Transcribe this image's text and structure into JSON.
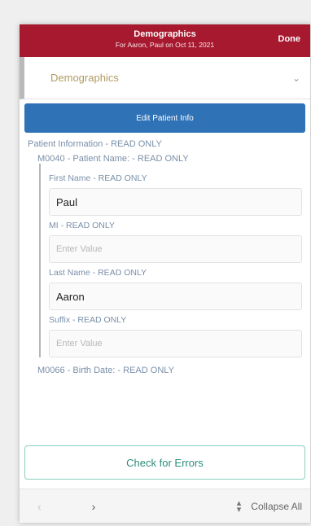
{
  "header": {
    "title": "Demographics",
    "subtitle": "For Aaron, Paul on Oct 11, 2021",
    "done_label": "Done"
  },
  "section": {
    "label": "Demographics",
    "chevron_icon": "chevron-down-icon"
  },
  "edit_button_label": "Edit Patient Info",
  "content": {
    "group_title": "Patient Information - READ ONLY",
    "patient_name_group": "M0040 - Patient Name: - READ ONLY",
    "fields": [
      {
        "label": "First Name - READ ONLY",
        "value": "Paul"
      },
      {
        "label": "MI - READ ONLY",
        "placeholder": "Enter Value"
      },
      {
        "label": "Last Name - READ ONLY",
        "value": "Aaron"
      },
      {
        "label": "Suffix - READ ONLY",
        "placeholder": "Enter Value"
      }
    ],
    "next_group": "M0066 - Birth Date: - READ ONLY"
  },
  "check_button_label": "Check for Errors",
  "footer": {
    "prev_icon": "chevron-left-icon",
    "next_icon": "chevron-right-icon",
    "collapse_icon": "collapse-arrows-icon",
    "collapse_label": "Collapse All"
  },
  "colors": {
    "header_bg": "#a6192e",
    "edit_button_bg": "#2f72b6",
    "check_button_text": "#2b8d7a",
    "label_text": "#7a8fa8",
    "section_label": "#b09b63"
  }
}
